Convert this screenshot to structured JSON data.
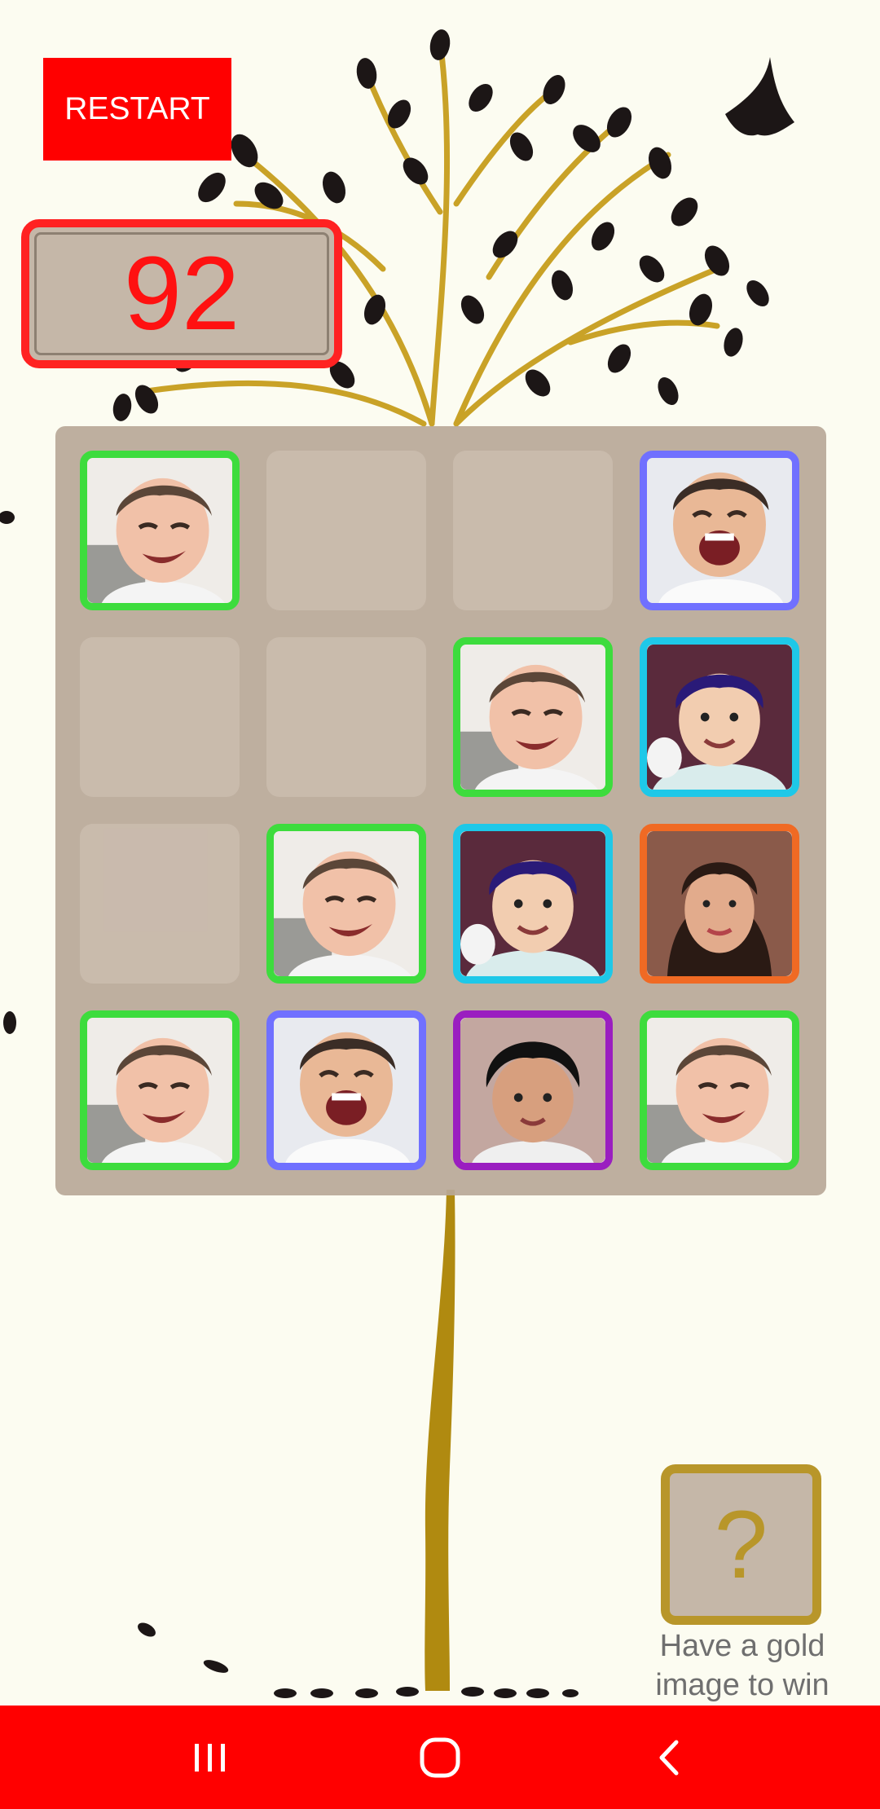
{
  "toolbar": {
    "restart_label": "RESTART"
  },
  "score": {
    "value": "92"
  },
  "board": {
    "rows": 4,
    "cols": 4,
    "tiles": [
      {
        "kind": "baby",
        "border": "#3ddc3d"
      },
      {
        "kind": "empty"
      },
      {
        "kind": "empty"
      },
      {
        "kind": "toddler-laughing",
        "border": "#7070ff"
      },
      {
        "kind": "empty"
      },
      {
        "kind": "empty"
      },
      {
        "kind": "baby",
        "border": "#3ddc3d"
      },
      {
        "kind": "boy-smiling",
        "border": "#1ec8e8"
      },
      {
        "kind": "empty"
      },
      {
        "kind": "baby",
        "border": "#3ddc3d"
      },
      {
        "kind": "boy-smiling",
        "border": "#1ec8e8"
      },
      {
        "kind": "woman",
        "border": "#f06a24"
      },
      {
        "kind": "baby",
        "border": "#3ddc3d"
      },
      {
        "kind": "toddler-laughing",
        "border": "#7070ff"
      },
      {
        "kind": "boy-dark-hair",
        "border": "#9a1ec0"
      },
      {
        "kind": "baby",
        "border": "#3ddc3d"
      }
    ]
  },
  "goal": {
    "symbol": "?",
    "hint": "Have a gold image to win"
  },
  "nav": {
    "recents_icon": "recents-icon",
    "home_icon": "home-icon",
    "back_icon": "back-icon"
  },
  "colors": {
    "accent": "#ff0000",
    "gold": "#b8962a",
    "board": "#b8a898"
  }
}
